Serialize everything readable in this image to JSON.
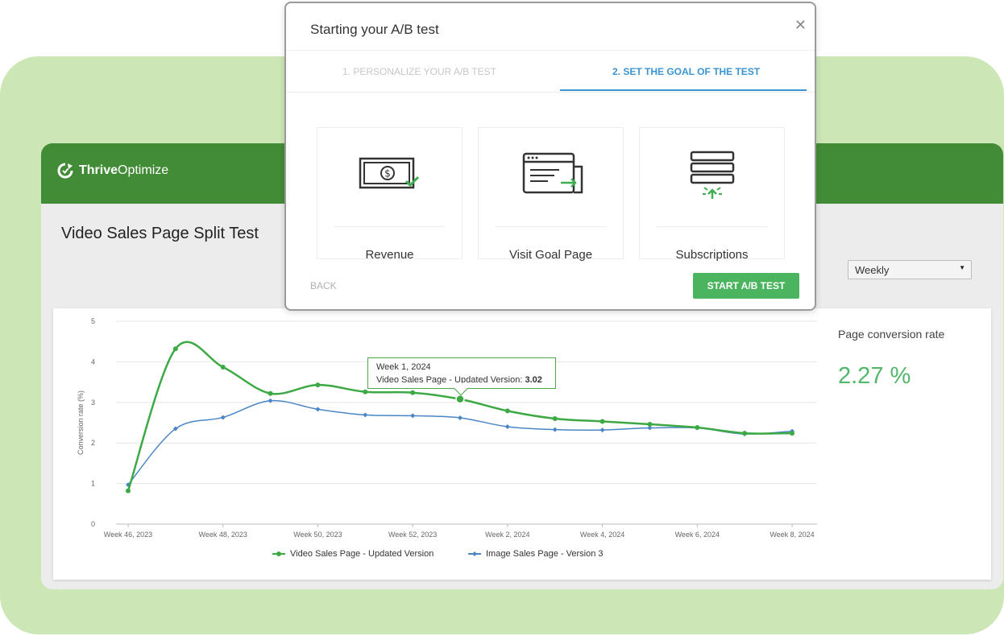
{
  "app": {
    "brand_bold": "Thrive",
    "brand_light": "Optimize",
    "page_title": "Video Sales Page Split Test",
    "period_select": "Weekly"
  },
  "modal": {
    "title": "Starting your A/B test",
    "close_icon": "close-icon",
    "tabs": [
      {
        "label": "1. PERSONALIZE YOUR A/B TEST",
        "active": false
      },
      {
        "label": "2. SET THE GOAL OF THE TEST",
        "active": true
      }
    ],
    "goals": [
      {
        "label": "Revenue",
        "icon": "money-check-icon"
      },
      {
        "label": "Visit Goal Page",
        "icon": "browser-window-icon"
      },
      {
        "label": "Subscriptions",
        "icon": "form-subscribe-icon"
      }
    ],
    "back_label": "BACK",
    "start_label": "START A/B TEST"
  },
  "stats": {
    "label": "Page conversion rate",
    "value": "2.27 %"
  },
  "tooltip": {
    "title": "Week 1, 2024",
    "series": "Video Sales Page - Updated  Version:",
    "value": "3.02"
  },
  "colors": {
    "header": "#438c37",
    "series_green": "#3da945",
    "series_blue": "#4a86c5",
    "accent_blue": "#3b94d1",
    "button_green": "#4bb45f"
  },
  "chart_data": {
    "type": "line",
    "ylabel": "Conversion rate (%)",
    "ylim": [
      0,
      5
    ],
    "yticks": [
      "0",
      "1",
      "2",
      "3",
      "4",
      "5"
    ],
    "xtick_labels": [
      "Week 46, 2023",
      "Week 48, 2023",
      "Week 50, 2023",
      "Week 52, 2023",
      "Week 2, 2024",
      "Week 4, 2024",
      "Week 6, 2024",
      "Week 8, 2024"
    ],
    "series": [
      {
        "name": "Video Sales Page - Updated  Version",
        "color": "#3da945",
        "values": [
          0.82,
          4.32,
          3.87,
          3.22,
          3.43,
          3.26,
          3.24,
          3.08,
          2.79,
          2.6,
          2.53,
          2.46,
          2.38,
          2.24,
          2.24
        ]
      },
      {
        "name": "Image Sales Page - Version 3",
        "color": "#4a86c5",
        "values": [
          0.97,
          2.35,
          2.63,
          3.04,
          2.83,
          2.69,
          2.67,
          2.62,
          2.4,
          2.33,
          2.32,
          2.37,
          2.37,
          2.22,
          2.29
        ]
      }
    ],
    "highlight": {
      "series": 0,
      "index": 7
    },
    "grid": true,
    "legend": "bottom"
  }
}
